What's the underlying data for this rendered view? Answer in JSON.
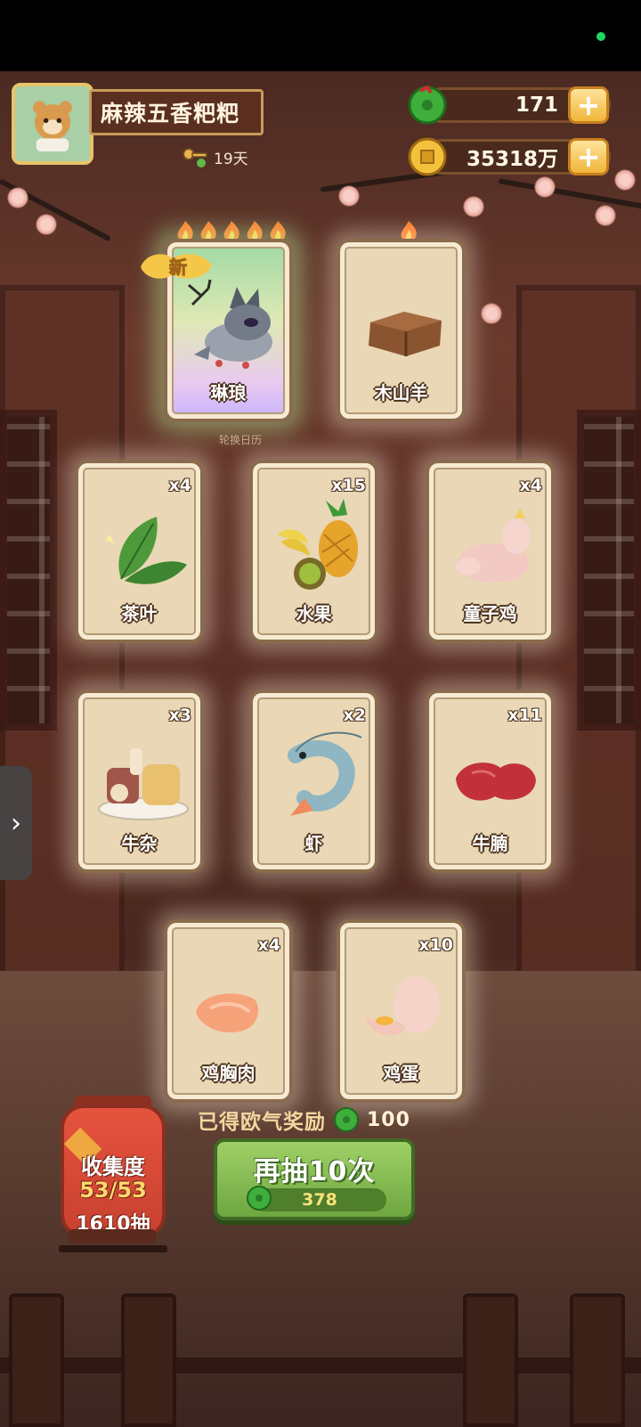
{
  "player": {
    "name": "麻辣五香粑粑",
    "days": "19天"
  },
  "resources": {
    "jade": "171",
    "coins": "35318万"
  },
  "cards_top": [
    {
      "name": "琳琅",
      "flames": 5,
      "is_new": true,
      "badge": "新"
    },
    {
      "name": "木山羊",
      "flames": 1,
      "is_new": false
    }
  ],
  "caption_under_card": "轮换日历",
  "cards": [
    {
      "name": "茶叶",
      "count": "x4"
    },
    {
      "name": "水果",
      "count": "x15"
    },
    {
      "name": "童子鸡",
      "count": "x4"
    },
    {
      "name": "牛杂",
      "count": "x3"
    },
    {
      "name": "虾",
      "count": "x2"
    },
    {
      "name": "牛腩",
      "count": "x11"
    },
    {
      "name": "鸡胸肉",
      "count": "x4"
    },
    {
      "name": "鸡蛋",
      "count": "x10"
    }
  ],
  "reward": {
    "label": "已得欧气奖励",
    "value": "100"
  },
  "collection": {
    "title": "收集度",
    "progress": "53/53",
    "draws": "1610抽"
  },
  "draw_button": {
    "label": "再抽10次",
    "cost": "378"
  },
  "side_tab": {
    "icon": "chevron-right-icon",
    "glyph": "›"
  },
  "colors": {
    "jade": "#3fae3a",
    "coin": "#f2c23c",
    "draw_button": "#8bc356",
    "lantern": "#d9483a"
  }
}
